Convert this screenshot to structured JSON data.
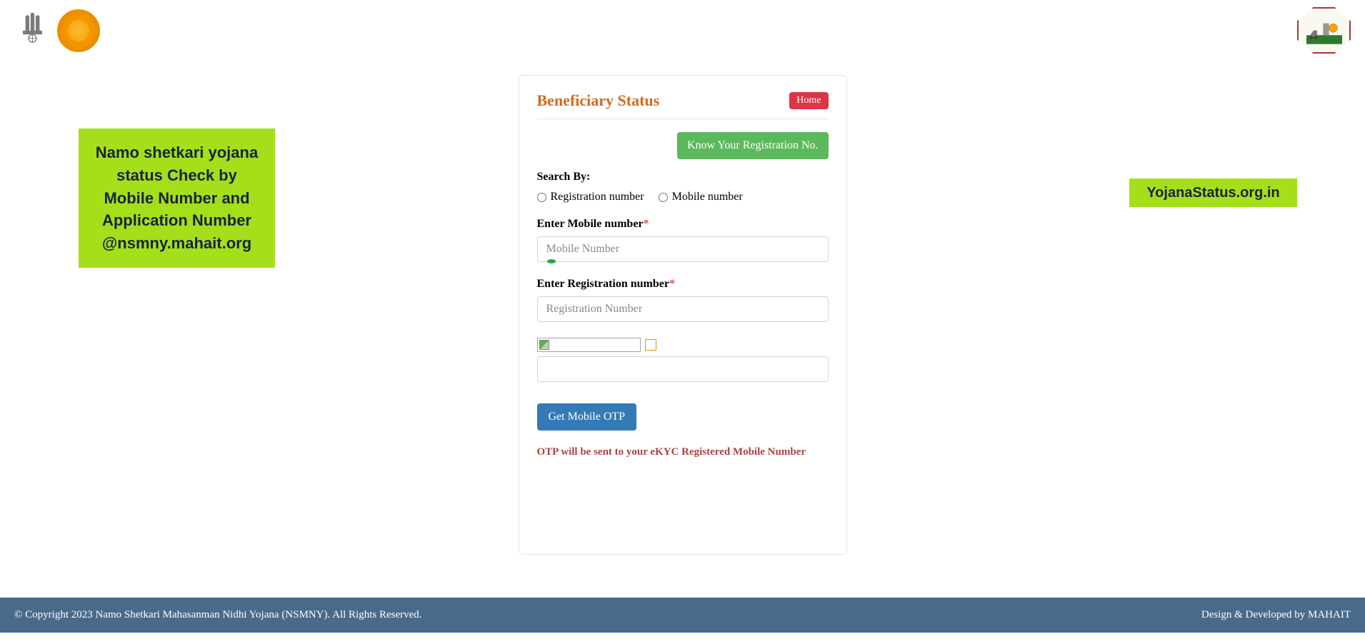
{
  "sideBannerLeft": "Namo shetkari yojana status Check by Mobile Number and Application Number @nsmny.mahait.org",
  "sideBannerRight": "YojanaStatus.org.in",
  "card": {
    "title": "Beneficiary Status",
    "homeLabel": "Home",
    "knowRegLabel": "Know Your Registration No.",
    "searchByLabel": "Search By:",
    "radioRegistration": "Registration number",
    "radioMobile": "Mobile number",
    "mobileLabel": "Enter Mobile number",
    "mobilePlaceholder": "Mobile Number",
    "regLabel": "Enter Registration number",
    "regPlaceholder": "Registration Number",
    "otpButton": "Get Mobile OTP",
    "otpNote": "OTP will be sent to your eKYC Registered Mobile Number"
  },
  "footer": {
    "copyright": "© Copyright 2023 Namo Shetkari Mahasanman Nidhi Yojana (NSMNY). All Rights Reserved.",
    "credits": "Design & Developed by MAHAIT"
  }
}
